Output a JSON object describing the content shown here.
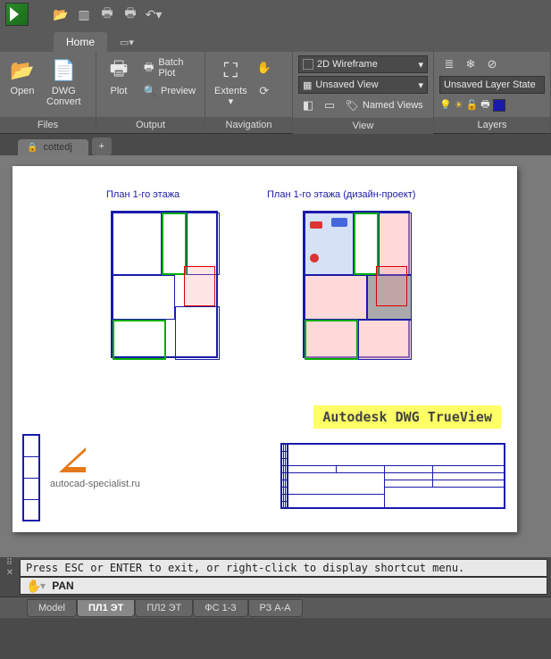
{
  "ribbon": {
    "active_tab": "Home",
    "panels": {
      "files": {
        "label": "Files",
        "open": "Open",
        "convert": "DWG\nConvert"
      },
      "output": {
        "label": "Output",
        "plot": "Plot",
        "batch": "Batch Plot",
        "preview": "Preview"
      },
      "navigation": {
        "label": "Navigation",
        "extents": "Extents"
      },
      "view": {
        "label": "View",
        "style": "2D Wireframe",
        "saved": "Unsaved View",
        "named": "Named Views"
      },
      "layers": {
        "label": "Layers",
        "state": "Unsaved Layer State"
      }
    }
  },
  "file_tab": "cottedj",
  "drawing": {
    "title1": "План 1-го этажа",
    "title2": "План 1-го этажа (дизайн-проект)",
    "watermark": "Autodesk DWG TrueView",
    "site": "autocad-specialist.ru"
  },
  "command": {
    "hint": "Press ESC or ENTER to exit, or right-click to display shortcut menu.",
    "current": "PAN"
  },
  "layout_tabs": [
    "Model",
    "ПЛ1 ЭТ",
    "ПЛ2 ЭТ",
    "ФС 1-3",
    "РЗ А-А"
  ],
  "layout_active": 1
}
